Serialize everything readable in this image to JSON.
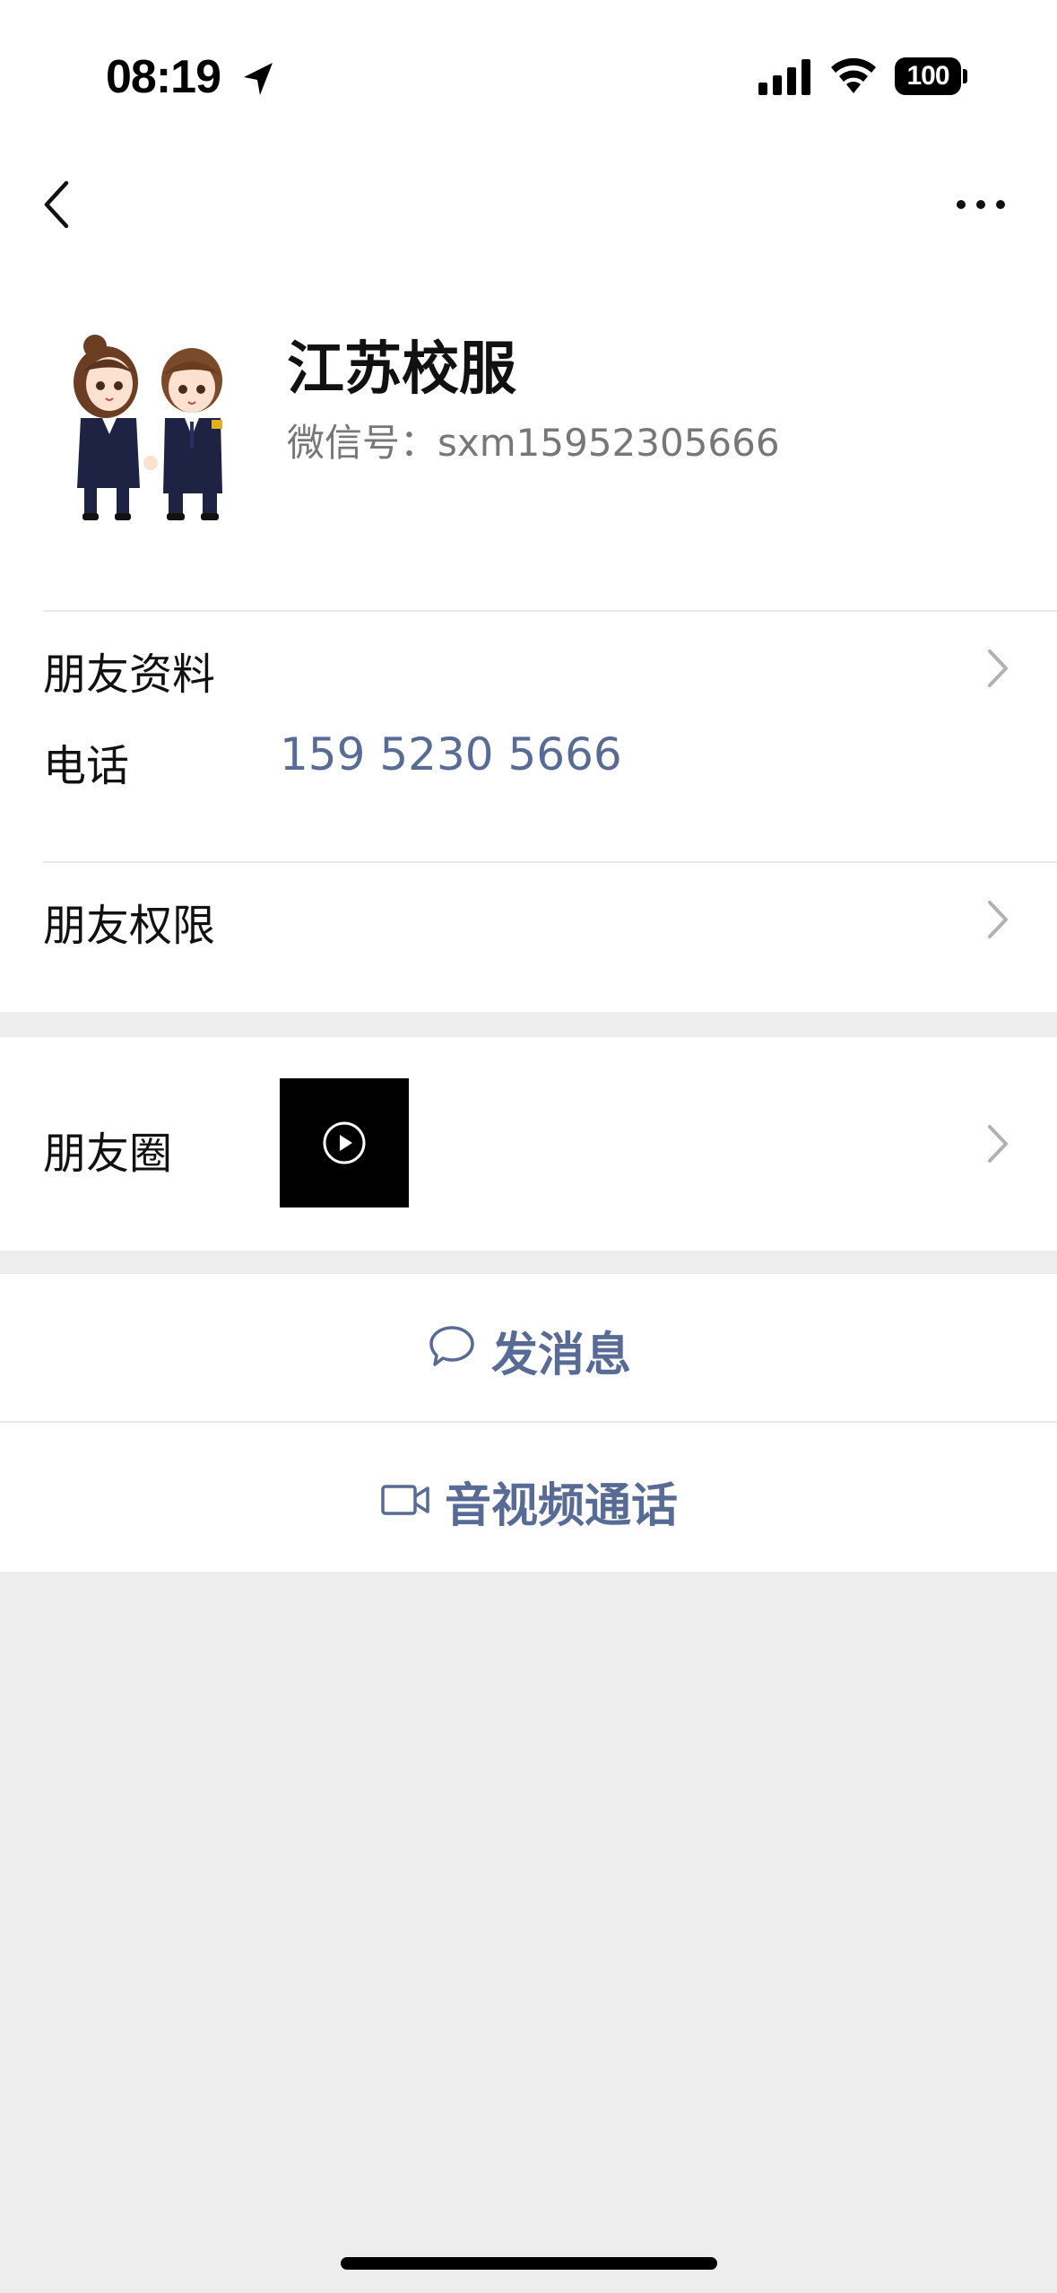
{
  "status_bar": {
    "time": "08:19",
    "battery": "100"
  },
  "nav": {
    "back_icon": "chevron-left-icon",
    "more_icon": "ellipsis-icon"
  },
  "profile": {
    "name": "江苏校服",
    "wechat_id": "微信号：sxm15952305666"
  },
  "info": {
    "friend_profile_label": "朋友资料",
    "phone_label": "电话",
    "phone_value": "159 5230 5666",
    "permissions_label": "朋友权限"
  },
  "moments": {
    "label": "朋友圈"
  },
  "actions": {
    "message_label": "发消息",
    "call_label": "音视频通话"
  },
  "colors": {
    "link": "#576b95",
    "background": "#ededed"
  }
}
